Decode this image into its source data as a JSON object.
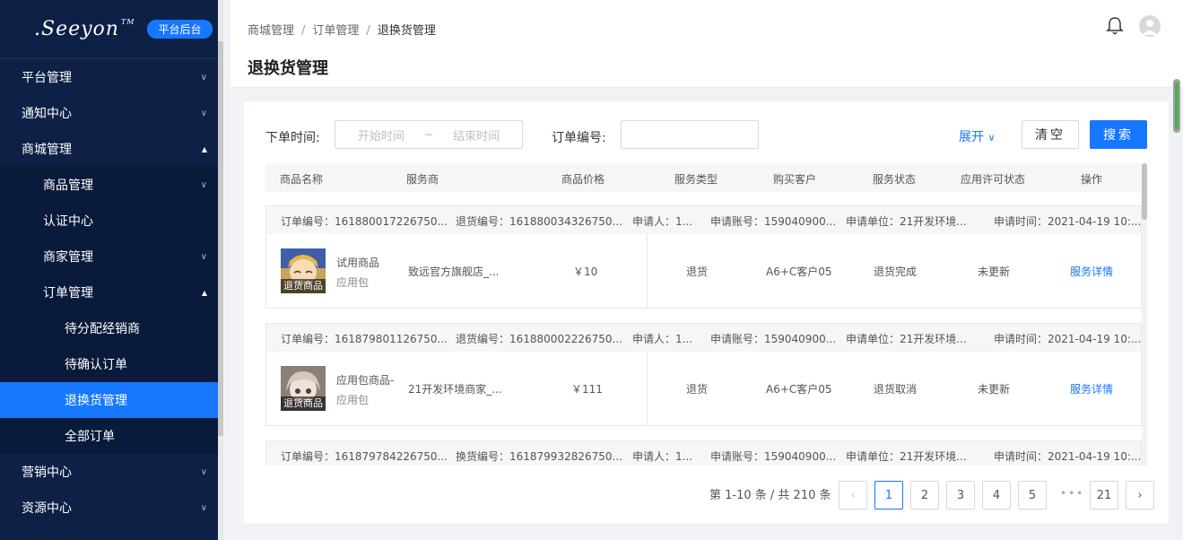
{
  "sidebar": {
    "logo_text": ".Seeyon",
    "logo_tm": "TM",
    "badge": "平台后台",
    "items": [
      {
        "label": "平台管理",
        "level": 1,
        "chevron": "down"
      },
      {
        "label": "通知中心",
        "level": 1,
        "chevron": "down"
      },
      {
        "label": "商城管理",
        "level": 1,
        "chevron": "up"
      },
      {
        "label": "商品管理",
        "level": 2,
        "chevron": "down"
      },
      {
        "label": "认证中心",
        "level": 2,
        "chevron": ""
      },
      {
        "label": "商家管理",
        "level": 2,
        "chevron": "down"
      },
      {
        "label": "订单管理",
        "level": 2,
        "chevron": "up"
      },
      {
        "label": "待分配经销商",
        "level": 3,
        "chevron": ""
      },
      {
        "label": "待确认订单",
        "level": 3,
        "chevron": ""
      },
      {
        "label": "退换货管理",
        "level": 3,
        "chevron": "",
        "active": true
      },
      {
        "label": "全部订单",
        "level": 3,
        "chevron": ""
      },
      {
        "label": "营销中心",
        "level": 1,
        "chevron": "down"
      },
      {
        "label": "资源中心",
        "level": 1,
        "chevron": "down"
      }
    ]
  },
  "header": {
    "breadcrumb": [
      "商城管理",
      "订单管理",
      "退换货管理"
    ],
    "separator": "/",
    "title": "退换货管理",
    "icons": [
      "bell-icon",
      "user-avatar-icon"
    ]
  },
  "filters": {
    "order_time_label": "下单时间:",
    "start_placeholder": "开始时间",
    "range_sep": "~",
    "end_placeholder": "结束时间",
    "order_no_label": "订单编号:",
    "order_no_value": "",
    "expand_label": "展开",
    "clear_label": "清空",
    "search_label": "搜索"
  },
  "table": {
    "columns": [
      "商品名称",
      "服务商",
      "商品价格",
      "服务类型",
      "购买客户",
      "服务状态",
      "应用许可状态",
      "操作"
    ],
    "orders": [
      {
        "order_no": "订单编号：161880017226750...",
        "service_no": "退货编号：161880034326750...",
        "applicant": "申请人：1...",
        "account": "申请账号：159040900...",
        "unit": "申请单位：21开发环境...",
        "time": "申请时间：2021-04-19 10:...",
        "tag": "退货商品",
        "product_name": "试用商品",
        "product_type": "应用包",
        "provider": "致远官方旗舰店_...",
        "price": "￥10",
        "service_type": "退货",
        "customer": "A6+C客户05",
        "status": "退货完成",
        "license": "未更新",
        "action": "服务详情"
      },
      {
        "order_no": "订单编号：161879801126750...",
        "service_no": "退货编号：161880002226750...",
        "applicant": "申请人：1...",
        "account": "申请账号：159040900...",
        "unit": "申请单位：21开发环境...",
        "time": "申请时间：2021-04-19 10:...",
        "tag": "退货商品",
        "product_name": "应用包商品-",
        "product_type": "应用包",
        "provider": "21开发环境商家_...",
        "price": "￥111",
        "service_type": "退货",
        "customer": "A6+C客户05",
        "status": "退货取消",
        "license": "未更新",
        "action": "服务详情"
      },
      {
        "order_no": "订单编号：161879784226750...",
        "service_no": "换货编号：161879932826750...",
        "applicant": "申请人：1...",
        "account": "申请账号：159040900...",
        "unit": "申请单位：21开发环境...",
        "time": "申请时间：2021-04-19 10:..."
      }
    ]
  },
  "pagination": {
    "total_text": "第 1-10 条 / 共 210 条",
    "pages": [
      "1",
      "2",
      "3",
      "4",
      "5"
    ],
    "dots": "•••",
    "last": "21",
    "current": "1"
  },
  "colors": {
    "sidebar_bg": "#0e2046",
    "accent": "#1677ff"
  }
}
